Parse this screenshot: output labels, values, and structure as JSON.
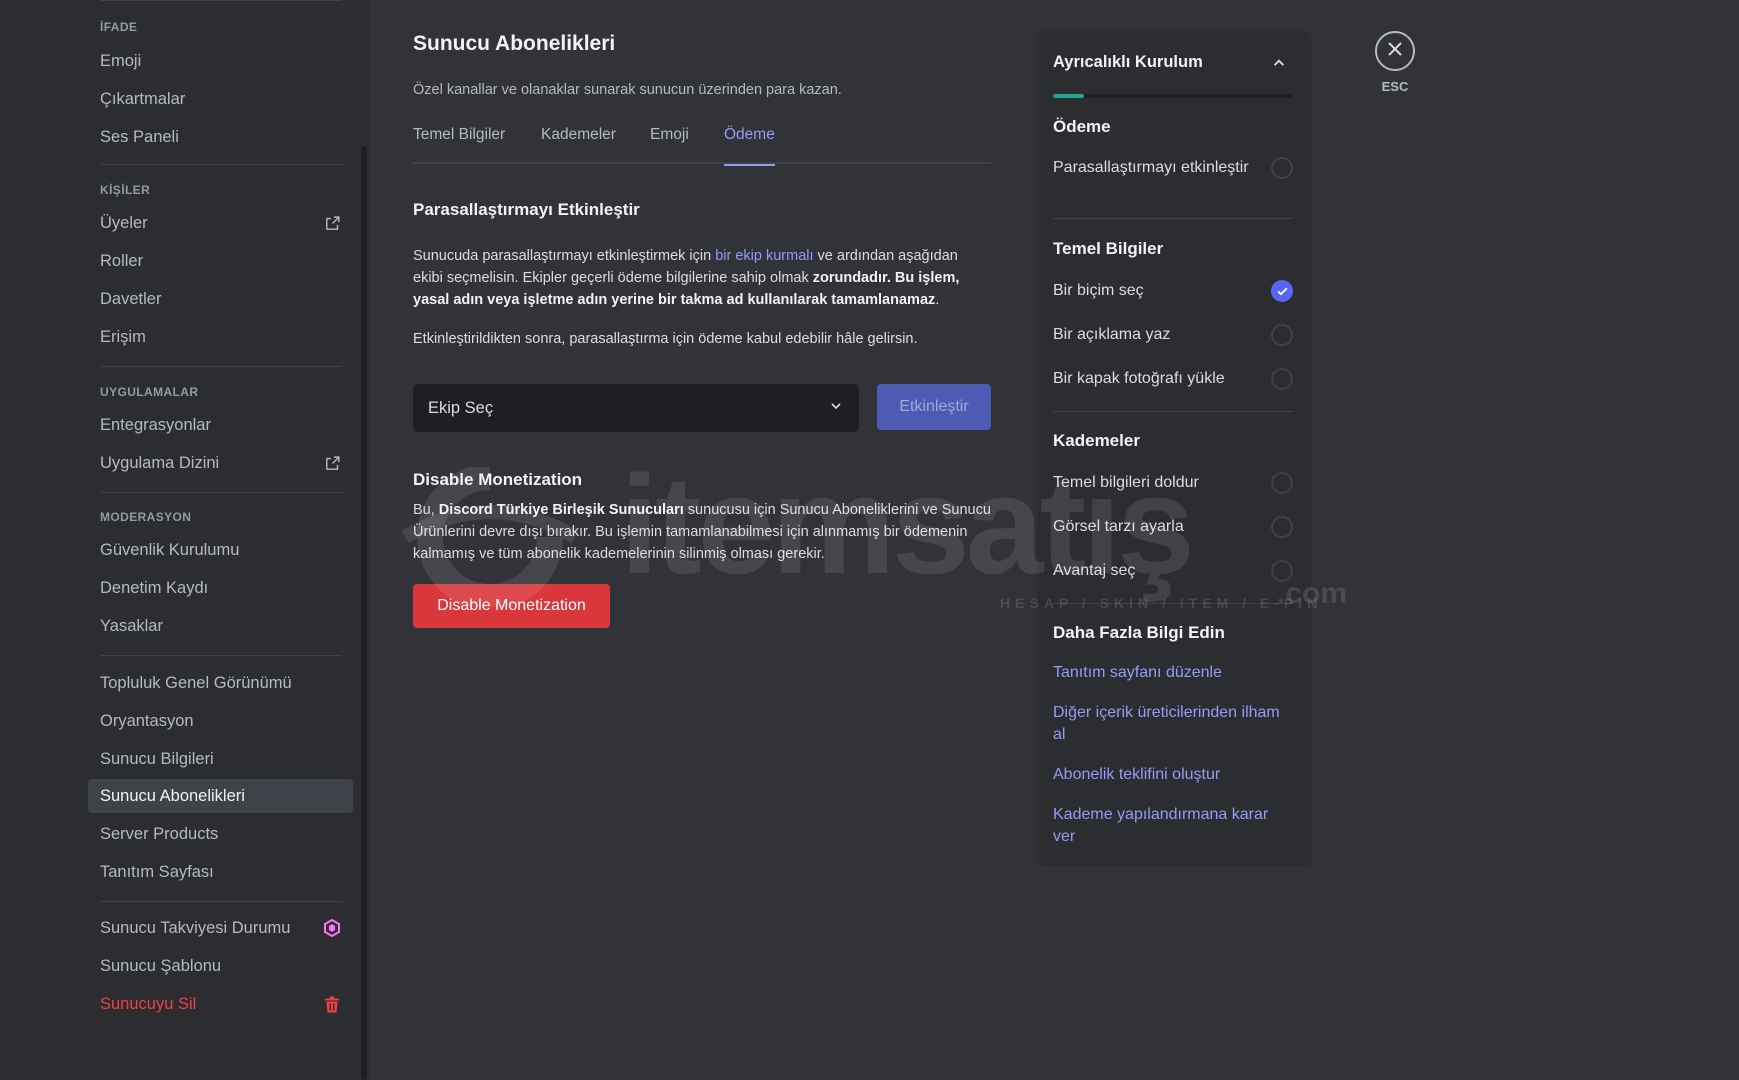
{
  "sidebar": {
    "sections": [
      {
        "heading": "İFADE",
        "items": [
          "Emoji",
          "Çıkartmalar",
          "Ses Paneli"
        ]
      },
      {
        "heading": "KİŞİLER",
        "items": [
          "Üyeler",
          "Roller",
          "Davetler",
          "Erişim"
        ]
      },
      {
        "heading": "UYGULAMALAR",
        "items": [
          "Entegrasyonlar",
          "Uygulama Dizini"
        ]
      },
      {
        "heading": "MODERASYON",
        "items": [
          "Güvenlik Kurulumu",
          "Denetim Kaydı",
          "Yasaklar"
        ]
      },
      {
        "heading": "",
        "items": [
          "Topluluk Genel Görünümü",
          "Oryantasyon",
          "Sunucu Bilgileri",
          "Sunucu Abonelikleri",
          "Server Products",
          "Tanıtım Sayfası"
        ]
      },
      {
        "heading": "",
        "items": [
          "Sunucu Takviyesi Durumu",
          "Sunucu Şablonu",
          "Sunucuyu Sil"
        ]
      }
    ],
    "active_item": "Sunucu Abonelikleri"
  },
  "main": {
    "title": "Sunucu Abonelikleri",
    "subtitle": "Özel kanallar ve olanaklar sunarak sunucun üzerinden para kazan.",
    "tabs": [
      "Temel Bilgiler",
      "Kademeler",
      "Emoji",
      "Ödeme"
    ],
    "active_tab": "Ödeme",
    "enable_section": {
      "title": "Parasallaştırmayı Etkinleştir",
      "p1_a": "Sunucuda parasallaştırmayı etkinleştirmek için ",
      "p1_link": "bir ekip kurmalı",
      "p1_b": " ve ardından aşağıdan ekibi seçmelisin. Ekipler geçerli ödeme bilgilerine sahip olmak ",
      "p1_bold": "zorundadır. Bu işlem, yasal adın veya işletme adın yerine bir takma ad kullanılarak tamamlanamaz",
      "p1_end": ".",
      "p2": "Etkinleştirildikten sonra, parasallaştırma için ödeme kabul edebilir hâle gelirsin.",
      "select_value": "Ekip Seç",
      "enable_button": "Etkinleştir"
    },
    "disable_section": {
      "title": "Disable Monetization",
      "p_a": "Bu, ",
      "p_bold": "Discord Türkiye Birleşik Sunucuları",
      "p_b": " sunucusu için Sunucu Aboneliklerini ve Sunucu Ürünlerini devre dışı bırakır. Bu işlemin tamamlanabilmesi için alınmamış bir ödemenin kalmamış ve tüm abonelik kademelerinin silinmiş olması gerekir.",
      "button": "Disable Monetization"
    }
  },
  "checklist": {
    "title": "Ayrıcalıklı Kurulum",
    "progress": 0.13,
    "groups": [
      {
        "title": "Ödeme",
        "items": [
          {
            "label": "Parasallaştırmayı etkinleştir",
            "done": false
          }
        ]
      },
      {
        "title": "Temel Bilgiler",
        "items": [
          {
            "label": "Bir biçim seç",
            "done": true
          },
          {
            "label": "Bir açıklama yaz",
            "done": false
          },
          {
            "label": "Bir kapak fotoğrafı yükle",
            "done": false
          }
        ]
      },
      {
        "title": "Kademeler",
        "items": [
          {
            "label": "Temel bilgileri doldur",
            "done": false
          },
          {
            "label": "Görsel tarzı ayarla",
            "done": false
          },
          {
            "label": "Avantaj seç",
            "done": false
          }
        ]
      }
    ],
    "learn_more": {
      "title": "Daha Fazla Bilgi Edin",
      "links": [
        "Tanıtım sayfanı düzenle",
        "Diğer içerik üreticilerinden ilham al",
        "Abonelik teklifini oluştur",
        "Kademe yapılandırmana karar ver"
      ]
    }
  },
  "esc_label": "ESC",
  "watermark": {
    "word": "itemsatış",
    "tagline": "HESAP / SKIN / ITEM / E-PIN",
    "suffix": ".com"
  },
  "colors": {
    "accent": "#949cf7",
    "danger": "#da373c",
    "check": "#5865f2",
    "progress": "#23a594",
    "boost": "#ff73fa"
  }
}
